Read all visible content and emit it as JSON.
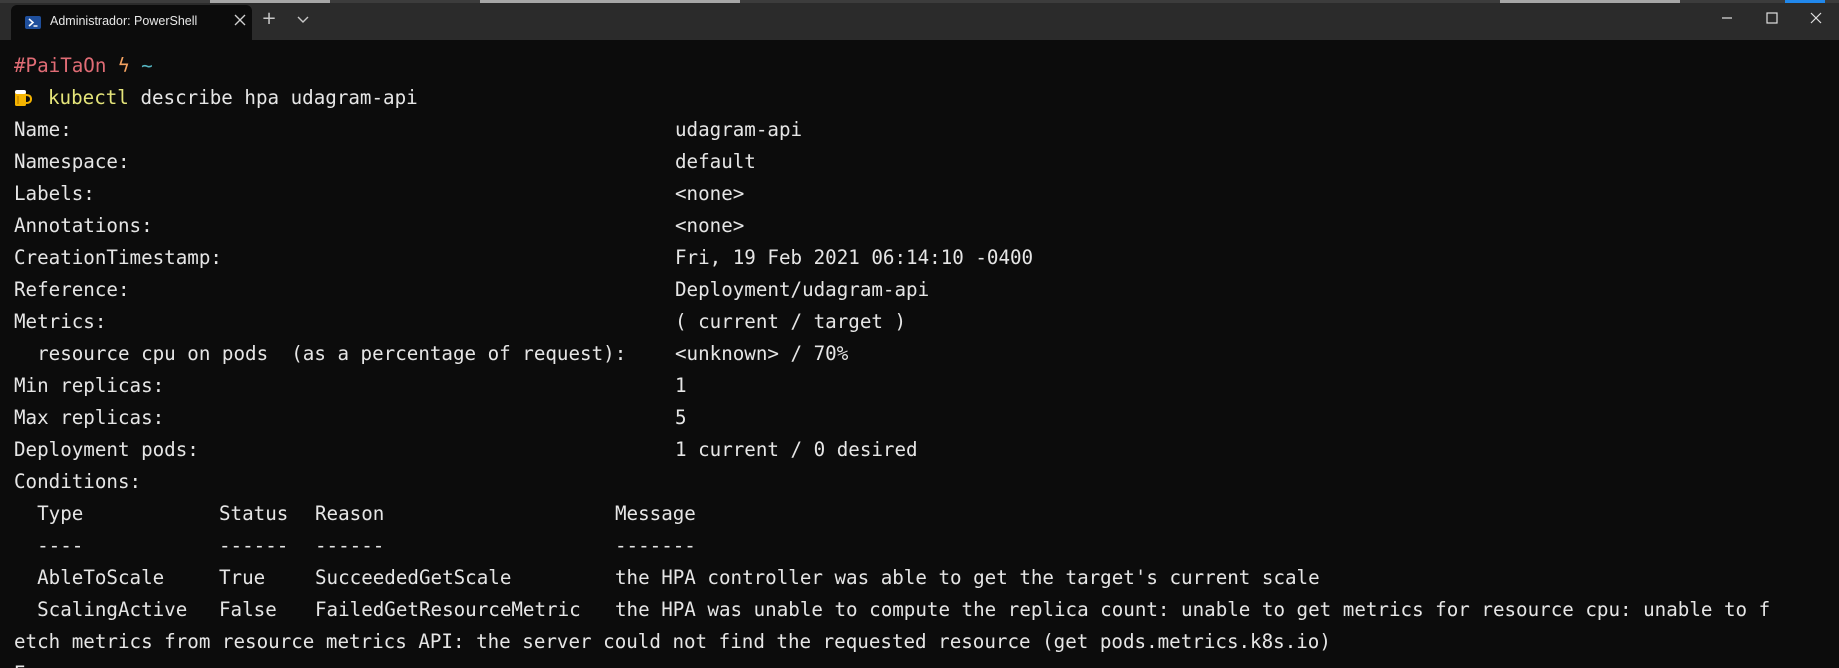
{
  "window": {
    "tab_title": "Administrador: PowerShell",
    "new_tab_symbol": "+",
    "icons": {
      "tab": "powershell-icon",
      "close_tab": "close-icon",
      "new_tab": "plus-icon",
      "dropdown": "chevron-down-icon",
      "minimize": "minimize-icon",
      "maximize": "maximize-icon",
      "close_window": "close-icon"
    }
  },
  "prompt": {
    "hash": "#PaiTaOn",
    "bolt": "ϟ",
    "tilde": "~",
    "beer_icon": "beer-icon",
    "command_name": "kubectl",
    "command_args": "describe hpa udagram-api"
  },
  "fields": [
    {
      "label": "Name:",
      "value": "udagram-api"
    },
    {
      "label": "Namespace:",
      "value": "default"
    },
    {
      "label": "Labels:",
      "value": "<none>"
    },
    {
      "label": "Annotations:",
      "value": "<none>"
    },
    {
      "label": "CreationTimestamp:",
      "value": "Fri, 19 Feb 2021 06:14:10 -0400"
    },
    {
      "label": "Reference:",
      "value": "Deployment/udagram-api"
    },
    {
      "label": "Metrics:",
      "value": "( current / target )"
    },
    {
      "label": "  resource cpu on pods  (as a percentage of request):",
      "value": "<unknown> / 70%"
    },
    {
      "label": "Min replicas:",
      "value": "1"
    },
    {
      "label": "Max replicas:",
      "value": "5"
    },
    {
      "label": "Deployment pods:",
      "value": "1 current / 0 desired"
    }
  ],
  "conditions": {
    "heading": "Conditions:",
    "columns": [
      "Type",
      "Status",
      "Reason",
      "Message"
    ],
    "separators": [
      "----",
      "------",
      "------",
      "-------"
    ],
    "rows": [
      {
        "type": "AbleToScale",
        "status": "True",
        "reason": "SucceededGetScale",
        "message": "the HPA controller was able to get the target's current scale"
      },
      {
        "type": "ScalingActive",
        "status": "False",
        "reason": "FailedGetResourceMetric",
        "message": "the HPA was unable to compute the replica count: unable to get metrics for resource cpu: unable to f"
      }
    ],
    "wrapped_line": "etch metrics from resource metrics API: the server could not find the requested resource (get pods.metrics.k8s.io)"
  },
  "next_line_partial": "Ev"
}
